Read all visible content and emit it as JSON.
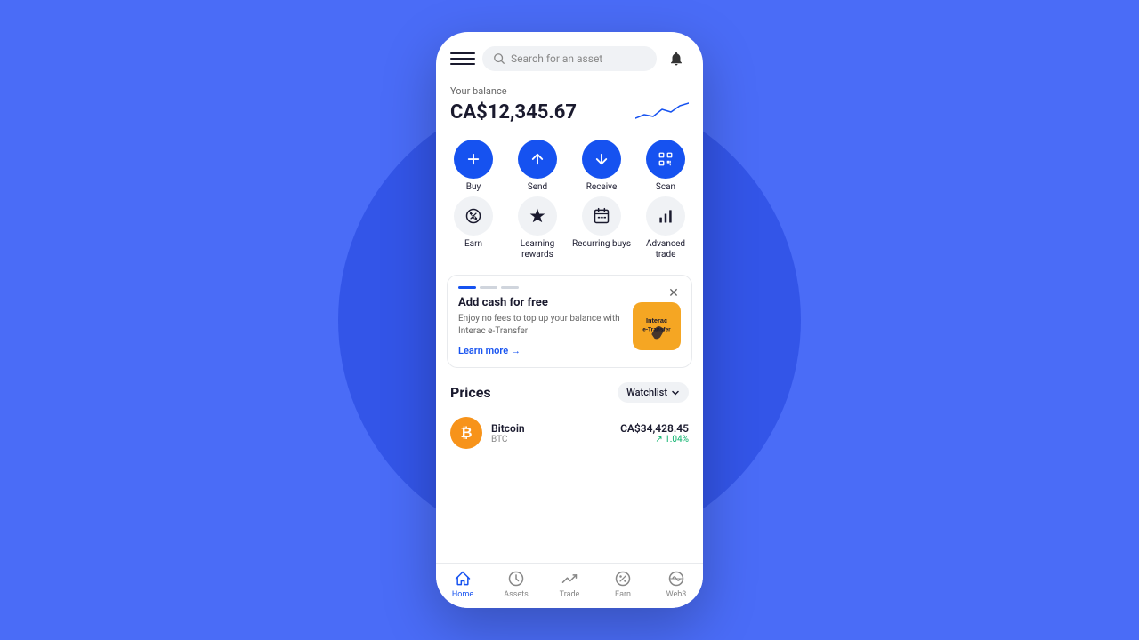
{
  "background": {
    "circle_color": "#3355e8"
  },
  "header": {
    "search_placeholder": "Search for an asset"
  },
  "balance": {
    "label": "Your balance",
    "amount": "CA$12,345.67"
  },
  "actions": [
    {
      "id": "buy",
      "label": "Buy",
      "icon": "plus",
      "style": "filled"
    },
    {
      "id": "send",
      "label": "Send",
      "icon": "arrow-up",
      "style": "filled"
    },
    {
      "id": "receive",
      "label": "Receive",
      "icon": "arrow-down",
      "style": "filled"
    },
    {
      "id": "scan",
      "label": "Scan",
      "icon": "scan",
      "style": "filled"
    },
    {
      "id": "earn",
      "label": "Earn",
      "icon": "percent",
      "style": "light"
    },
    {
      "id": "learning-rewards",
      "label": "Learning rewards",
      "icon": "diamond",
      "style": "light"
    },
    {
      "id": "recurring-buys",
      "label": "Recurring buys",
      "icon": "calendar",
      "style": "light"
    },
    {
      "id": "advanced-trade",
      "label": "Advanced trade",
      "icon": "chart",
      "style": "light"
    }
  ],
  "promo": {
    "title": "Add cash for free",
    "description": "Enjoy no fees to top up your balance with Interac e-Transfer",
    "learn_more": "Learn more",
    "dots": [
      true,
      false,
      false
    ]
  },
  "prices": {
    "title": "Prices",
    "watchlist_label": "Watchlist",
    "assets": [
      {
        "name": "Bitcoin",
        "symbol": "BTC",
        "price": "CA$34,428.45",
        "change": "↗ 1.04%",
        "icon_color": "#f7931a",
        "icon_letter": "₿"
      }
    ]
  },
  "nav": {
    "items": [
      {
        "id": "home",
        "label": "Home",
        "active": true
      },
      {
        "id": "assets",
        "label": "Assets",
        "active": false
      },
      {
        "id": "trade",
        "label": "Trade",
        "active": false
      },
      {
        "id": "earn",
        "label": "Earn",
        "active": false
      },
      {
        "id": "web3",
        "label": "Web3",
        "active": false
      }
    ]
  }
}
